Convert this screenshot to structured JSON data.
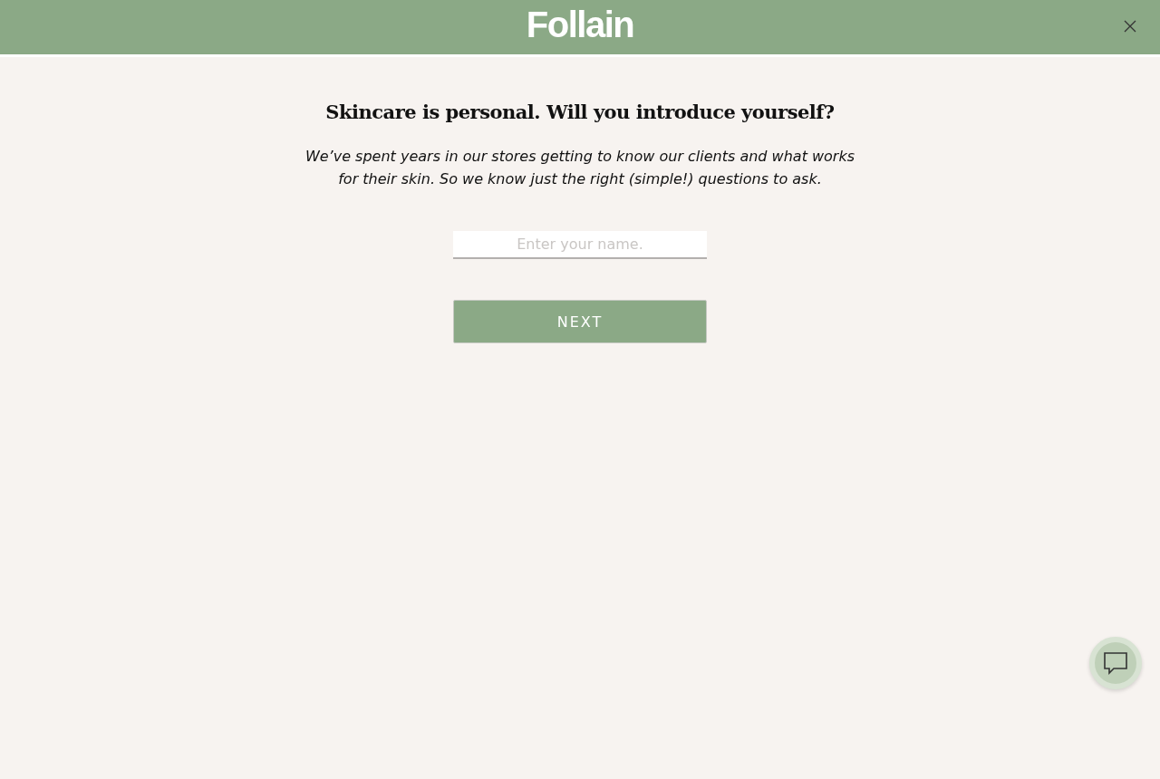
{
  "header": {
    "logo": "Follain"
  },
  "intro": {
    "heading": "Skincare is personal. Will you introduce yourself?",
    "text": "We’ve spent years in our stores getting to know our clients and what works for their skin. So we know just the right (simple!) questions to ask."
  },
  "name_field": {
    "placeholder": "Enter your name."
  },
  "next_button": "NEXT"
}
